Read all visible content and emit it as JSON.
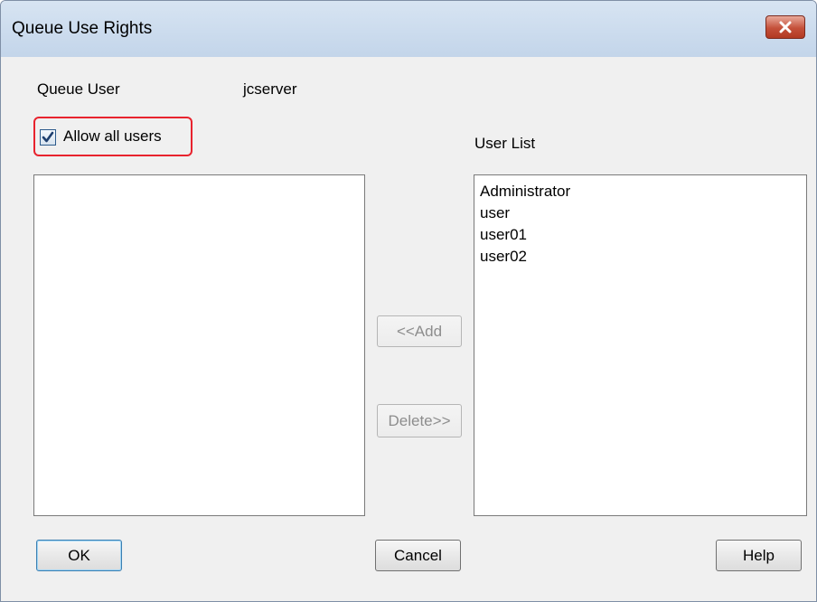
{
  "window": {
    "title": "Queue Use Rights"
  },
  "queue_user": {
    "label": "Queue User",
    "value": "jcserver"
  },
  "allow_all": {
    "label": "Allow all users",
    "checked": true
  },
  "user_list": {
    "label": "User List",
    "items": [
      "Administrator",
      "user",
      "user01",
      "user02"
    ]
  },
  "allowed_list": {
    "items": []
  },
  "buttons": {
    "add": "<<Add",
    "delete": "Delete>>",
    "ok": "OK",
    "cancel": "Cancel",
    "help": "Help"
  },
  "colors": {
    "highlight": "#e8232e",
    "close_button": "#c4503a"
  }
}
